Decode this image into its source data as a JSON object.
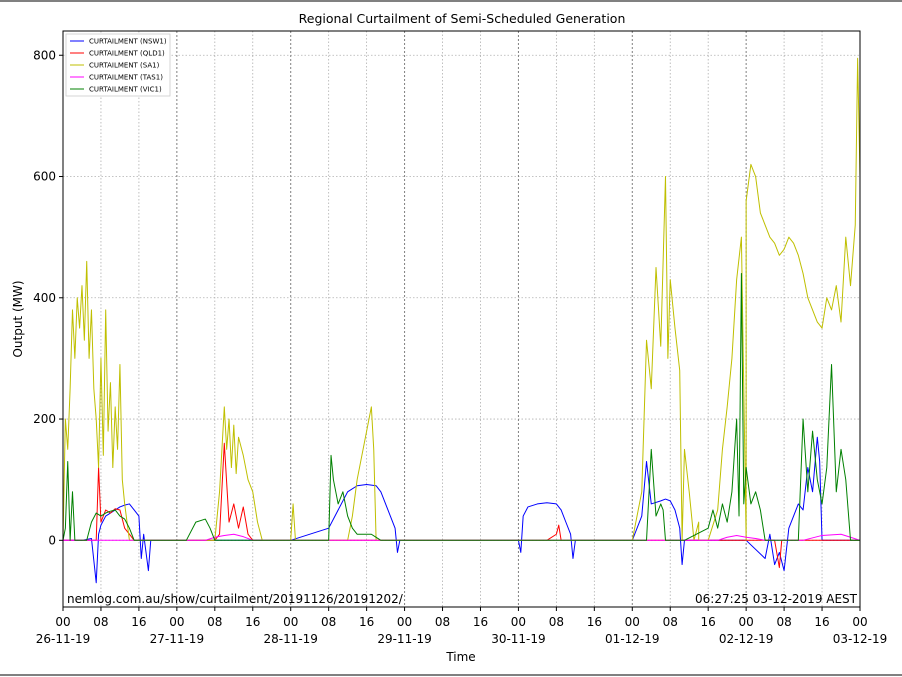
{
  "chart_data": {
    "type": "line",
    "title": "Regional Curtailment of Semi-Scheduled Generation",
    "xlabel": "Time",
    "ylabel": "Output (MW)",
    "ylim": [
      -110,
      840
    ],
    "yticks": [
      0,
      200,
      400,
      600,
      800
    ],
    "x_range_hours": [
      0,
      168
    ],
    "x_hour_ticks": [
      "00",
      "08",
      "16",
      "00",
      "08",
      "16",
      "00",
      "08",
      "16",
      "00",
      "08",
      "16",
      "00",
      "08",
      "16",
      "00",
      "08",
      "16",
      "00",
      "08",
      "16",
      "00"
    ],
    "x_date_ticks": [
      "26-11-19",
      "27-11-19",
      "28-11-19",
      "29-11-19",
      "30-11-19",
      "01-12-19",
      "02-12-19",
      "03-12-19"
    ],
    "grid": true,
    "legend_position": "top-left",
    "footer_left": "nemlog.com.au/show/curtailment/20191126/20191202/",
    "footer_right": "06:27:25 03-12-2019 AEST",
    "series": [
      {
        "name": "CURTAILMENT (NSW1)",
        "color": "#0000ff",
        "points": [
          [
            0,
            0
          ],
          [
            4,
            0
          ],
          [
            6,
            3
          ],
          [
            7,
            -70
          ],
          [
            7.5,
            10
          ],
          [
            8,
            25
          ],
          [
            9,
            40
          ],
          [
            10,
            45
          ],
          [
            11,
            50
          ],
          [
            12,
            55
          ],
          [
            13,
            58
          ],
          [
            14,
            60
          ],
          [
            15,
            50
          ],
          [
            16,
            40
          ],
          [
            16.5,
            -30
          ],
          [
            17,
            10
          ],
          [
            18,
            -50
          ],
          [
            18.5,
            0
          ],
          [
            24,
            0
          ],
          [
            48,
            0
          ],
          [
            56,
            20
          ],
          [
            58,
            50
          ],
          [
            60,
            80
          ],
          [
            62,
            90
          ],
          [
            64,
            92
          ],
          [
            66,
            90
          ],
          [
            67,
            80
          ],
          [
            68,
            60
          ],
          [
            69,
            40
          ],
          [
            70,
            20
          ],
          [
            70.5,
            -20
          ],
          [
            71,
            0
          ],
          [
            96,
            0
          ],
          [
            96.5,
            -20
          ],
          [
            97,
            40
          ],
          [
            98,
            55
          ],
          [
            100,
            60
          ],
          [
            102,
            62
          ],
          [
            104,
            60
          ],
          [
            105,
            50
          ],
          [
            106,
            30
          ],
          [
            107,
            10
          ],
          [
            107.5,
            -30
          ],
          [
            108,
            0
          ],
          [
            120,
            0
          ],
          [
            122,
            40
          ],
          [
            123,
            130
          ],
          [
            124,
            60
          ],
          [
            126,
            65
          ],
          [
            127,
            68
          ],
          [
            128,
            65
          ],
          [
            129,
            50
          ],
          [
            130,
            20
          ],
          [
            130.5,
            -40
          ],
          [
            131,
            0
          ],
          [
            144,
            0
          ],
          [
            148,
            -30
          ],
          [
            149,
            10
          ],
          [
            150,
            -40
          ],
          [
            151,
            -20
          ],
          [
            152,
            -50
          ],
          [
            153,
            20
          ],
          [
            154,
            40
          ],
          [
            155,
            60
          ],
          [
            156,
            50
          ],
          [
            157,
            120
          ],
          [
            158,
            80
          ],
          [
            159,
            170
          ],
          [
            159.5,
            130
          ],
          [
            160,
            0
          ],
          [
            168,
            0
          ]
        ]
      },
      {
        "name": "CURTAILMENT (QLD1)",
        "color": "#ff0000",
        "points": [
          [
            0,
            0
          ],
          [
            7,
            0
          ],
          [
            7.5,
            120
          ],
          [
            8,
            30
          ],
          [
            9,
            50
          ],
          [
            10,
            45
          ],
          [
            11,
            52
          ],
          [
            12,
            50
          ],
          [
            13,
            20
          ],
          [
            14,
            10
          ],
          [
            15,
            0
          ],
          [
            24,
            0
          ],
          [
            32,
            0
          ],
          [
            33,
            10
          ],
          [
            34,
            160
          ],
          [
            35,
            30
          ],
          [
            36,
            60
          ],
          [
            37,
            20
          ],
          [
            38,
            55
          ],
          [
            39,
            10
          ],
          [
            40,
            0
          ],
          [
            72,
            0
          ],
          [
            96,
            0
          ],
          [
            100,
            0
          ],
          [
            102,
            0
          ],
          [
            104,
            10
          ],
          [
            104.5,
            25
          ],
          [
            105,
            0
          ],
          [
            144,
            0
          ],
          [
            150,
            0
          ],
          [
            151,
            -45
          ],
          [
            151.5,
            0
          ],
          [
            168,
            0
          ]
        ]
      },
      {
        "name": "CURTAILMENT (SA1)",
        "color": "#bfbf00",
        "points": [
          [
            0,
            0
          ],
          [
            0.5,
            200
          ],
          [
            1,
            150
          ],
          [
            1.5,
            250
          ],
          [
            2,
            380
          ],
          [
            2.5,
            300
          ],
          [
            3,
            400
          ],
          [
            3.5,
            350
          ],
          [
            4,
            420
          ],
          [
            4.5,
            330
          ],
          [
            5,
            460
          ],
          [
            5.5,
            300
          ],
          [
            6,
            380
          ],
          [
            6.5,
            250
          ],
          [
            7,
            200
          ],
          [
            7.5,
            120
          ],
          [
            8,
            300
          ],
          [
            8.5,
            140
          ],
          [
            9,
            380
          ],
          [
            9.5,
            180
          ],
          [
            10,
            260
          ],
          [
            10.5,
            120
          ],
          [
            11,
            220
          ],
          [
            11.5,
            150
          ],
          [
            12,
            290
          ],
          [
            12.5,
            100
          ],
          [
            13,
            60
          ],
          [
            14,
            0
          ],
          [
            24,
            0
          ],
          [
            32,
            0
          ],
          [
            33,
            80
          ],
          [
            34,
            220
          ],
          [
            34.5,
            150
          ],
          [
            35,
            200
          ],
          [
            35.5,
            120
          ],
          [
            36,
            190
          ],
          [
            36.5,
            110
          ],
          [
            37,
            170
          ],
          [
            38,
            140
          ],
          [
            39,
            100
          ],
          [
            40,
            80
          ],
          [
            41,
            30
          ],
          [
            42,
            0
          ],
          [
            48,
            0
          ],
          [
            48.5,
            60
          ],
          [
            49,
            0
          ],
          [
            60,
            0
          ],
          [
            61,
            40
          ],
          [
            62,
            100
          ],
          [
            63,
            140
          ],
          [
            64,
            180
          ],
          [
            65,
            220
          ],
          [
            65.5,
            150
          ],
          [
            66,
            0
          ],
          [
            72,
            0
          ],
          [
            120,
            0
          ],
          [
            122,
            80
          ],
          [
            123,
            330
          ],
          [
            124,
            250
          ],
          [
            125,
            450
          ],
          [
            126,
            320
          ],
          [
            127,
            600
          ],
          [
            127.5,
            300
          ],
          [
            128,
            430
          ],
          [
            129,
            350
          ],
          [
            130,
            280
          ],
          [
            131,
            150
          ],
          [
            132,
            80
          ],
          [
            133,
            0
          ],
          [
            134,
            30
          ],
          [
            135,
            0
          ],
          [
            144,
            0
          ],
          [
            130.5,
            0
          ],
          [
            134,
            0
          ],
          [
            136,
            0
          ],
          [
            138,
            50
          ],
          [
            139,
            150
          ],
          [
            140,
            220
          ],
          [
            141,
            300
          ],
          [
            142,
            430
          ],
          [
            143,
            500
          ],
          [
            144,
            560
          ],
          [
            145,
            620
          ],
          [
            146,
            600
          ],
          [
            147,
            540
          ],
          [
            148,
            520
          ],
          [
            149,
            500
          ],
          [
            150,
            490
          ],
          [
            151,
            470
          ],
          [
            152,
            480
          ],
          [
            153,
            500
          ],
          [
            154,
            490
          ],
          [
            155,
            470
          ],
          [
            156,
            440
          ],
          [
            157,
            400
          ],
          [
            158,
            380
          ],
          [
            159,
            360
          ],
          [
            160,
            350
          ],
          [
            161,
            400
          ],
          [
            162,
            380
          ],
          [
            163,
            420
          ],
          [
            164,
            360
          ],
          [
            165,
            500
          ],
          [
            166,
            420
          ],
          [
            167,
            520
          ],
          [
            167.5,
            795
          ],
          [
            168,
            600
          ]
        ]
      },
      {
        "name": "CURTAILMENT (TAS1)",
        "color": "#ff00ff",
        "points": [
          [
            0,
            0
          ],
          [
            30,
            0
          ],
          [
            32,
            5
          ],
          [
            34,
            8
          ],
          [
            36,
            10
          ],
          [
            38,
            6
          ],
          [
            40,
            0
          ],
          [
            96,
            0
          ],
          [
            138,
            0
          ],
          [
            140,
            5
          ],
          [
            142,
            8
          ],
          [
            144,
            5
          ],
          [
            146,
            3
          ],
          [
            148,
            0
          ],
          [
            156,
            0
          ],
          [
            160,
            8
          ],
          [
            164,
            10
          ],
          [
            166,
            5
          ],
          [
            168,
            0
          ]
        ]
      },
      {
        "name": "CURTAILMENT (VIC1)",
        "color": "#008000",
        "points": [
          [
            0,
            0
          ],
          [
            0.5,
            20
          ],
          [
            1,
            130
          ],
          [
            1.5,
            0
          ],
          [
            2,
            80
          ],
          [
            2.5,
            0
          ],
          [
            5,
            0
          ],
          [
            6,
            30
          ],
          [
            7,
            45
          ],
          [
            8,
            40
          ],
          [
            9,
            45
          ],
          [
            10,
            48
          ],
          [
            11,
            50
          ],
          [
            12,
            40
          ],
          [
            13,
            35
          ],
          [
            14,
            20
          ],
          [
            15,
            0
          ],
          [
            24,
            0
          ],
          [
            26,
            0
          ],
          [
            28,
            30
          ],
          [
            30,
            35
          ],
          [
            31,
            20
          ],
          [
            32,
            0
          ],
          [
            48,
            0
          ],
          [
            56,
            0
          ],
          [
            56.5,
            140
          ],
          [
            57,
            100
          ],
          [
            58,
            60
          ],
          [
            59,
            80
          ],
          [
            60,
            40
          ],
          [
            61,
            20
          ],
          [
            62,
            10
          ],
          [
            64,
            10
          ],
          [
            65,
            10
          ],
          [
            66,
            5
          ],
          [
            67,
            0
          ],
          [
            72,
            0
          ],
          [
            120,
            0
          ],
          [
            123,
            0
          ],
          [
            124,
            150
          ],
          [
            125,
            40
          ],
          [
            126,
            60
          ],
          [
            126.5,
            50
          ],
          [
            127,
            0
          ],
          [
            131,
            0
          ],
          [
            136,
            20
          ],
          [
            137,
            50
          ],
          [
            138,
            20
          ],
          [
            139,
            60
          ],
          [
            140,
            30
          ],
          [
            141,
            80
          ],
          [
            142,
            200
          ],
          [
            142.5,
            40
          ],
          [
            143,
            440
          ],
          [
            143.5,
            60
          ],
          [
            144,
            120
          ],
          [
            145,
            60
          ],
          [
            146,
            80
          ],
          [
            147,
            50
          ],
          [
            148,
            0
          ],
          [
            155,
            0
          ],
          [
            156,
            200
          ],
          [
            157,
            80
          ],
          [
            158,
            180
          ],
          [
            159,
            100
          ],
          [
            160,
            60
          ],
          [
            161,
            120
          ],
          [
            162,
            290
          ],
          [
            163,
            80
          ],
          [
            164,
            150
          ],
          [
            165,
            100
          ],
          [
            166,
            0
          ],
          [
            168,
            0
          ]
        ]
      }
    ]
  }
}
